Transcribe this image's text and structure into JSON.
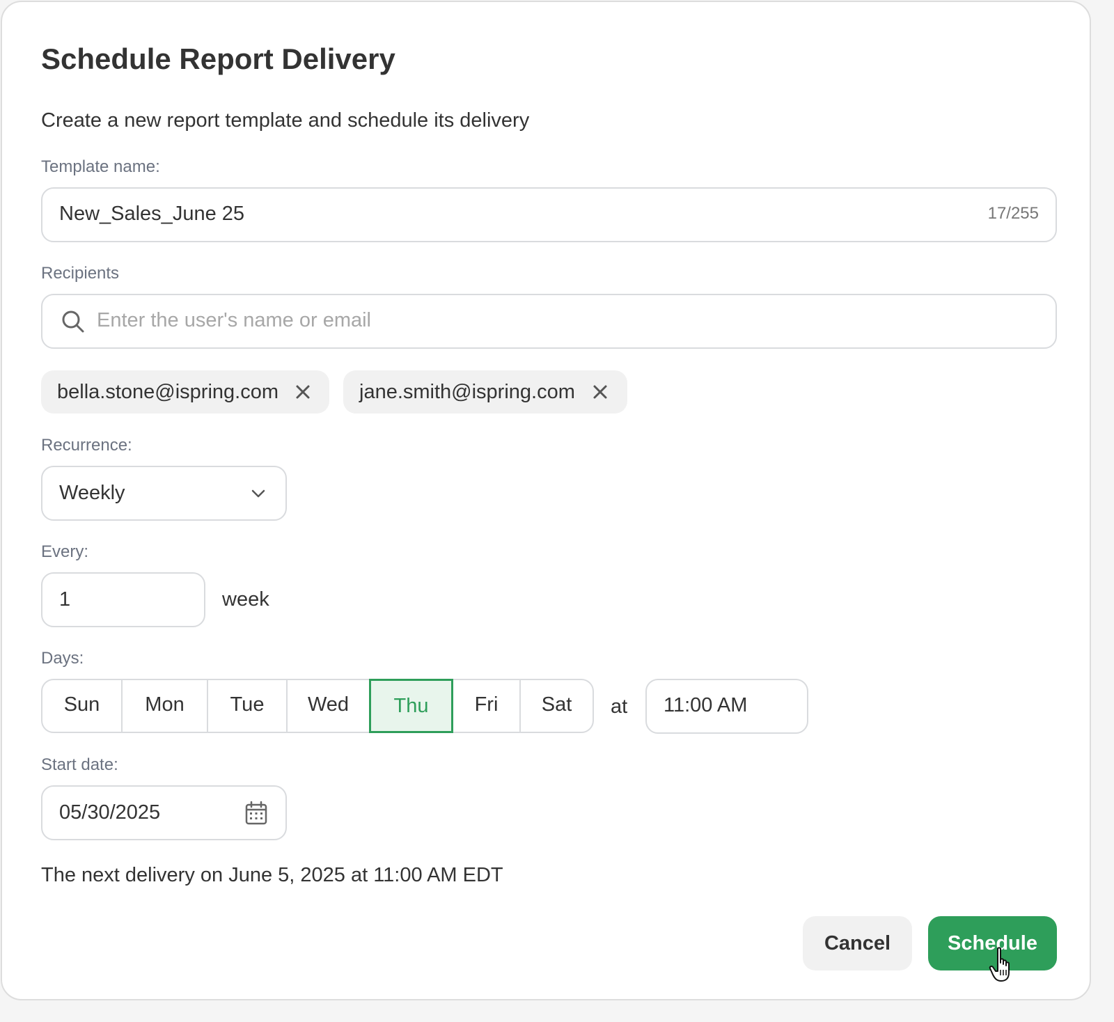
{
  "dialog": {
    "title": "Schedule Report Delivery",
    "subtitle": "Create a new report template and schedule its delivery"
  },
  "template": {
    "label": "Template name:",
    "value": "New_Sales_June 25",
    "counter": "17/255"
  },
  "recipients": {
    "label": "Recipients",
    "placeholder": "Enter the user's name or email",
    "search_icon": "search-icon",
    "chips": [
      {
        "email": "bella.stone@ispring.com",
        "remove_icon": "close-icon"
      },
      {
        "email": "jane.smith@ispring.com",
        "remove_icon": "close-icon"
      }
    ]
  },
  "recurrence": {
    "label": "Recurrence:",
    "selected": "Weekly",
    "dropdown_icon": "chevron-down-icon"
  },
  "every": {
    "label": "Every:",
    "value": "1",
    "unit": "week"
  },
  "days": {
    "label": "Days:",
    "items": [
      {
        "label": "Sun",
        "selected": false
      },
      {
        "label": "Mon",
        "selected": false
      },
      {
        "label": "Tue",
        "selected": false
      },
      {
        "label": "Wed",
        "selected": false
      },
      {
        "label": "Thu",
        "selected": true
      },
      {
        "label": "Fri",
        "selected": false
      },
      {
        "label": "Sat",
        "selected": false
      }
    ],
    "at_text": "at",
    "time": "11:00 AM"
  },
  "start_date": {
    "label": "Start date:",
    "value": "05/30/2025",
    "calendar_icon": "calendar-icon"
  },
  "next_delivery": "The next delivery on June 5, 2025 at 11:00 AM EDT",
  "actions": {
    "cancel_label": "Cancel",
    "schedule_label": "Schedule"
  },
  "colors": {
    "accent": "#2e9e5a",
    "selected_bg": "#e8f5ec",
    "chip_bg": "#f1f1f1",
    "border": "#d9dbde",
    "muted_text": "#6b7280"
  }
}
